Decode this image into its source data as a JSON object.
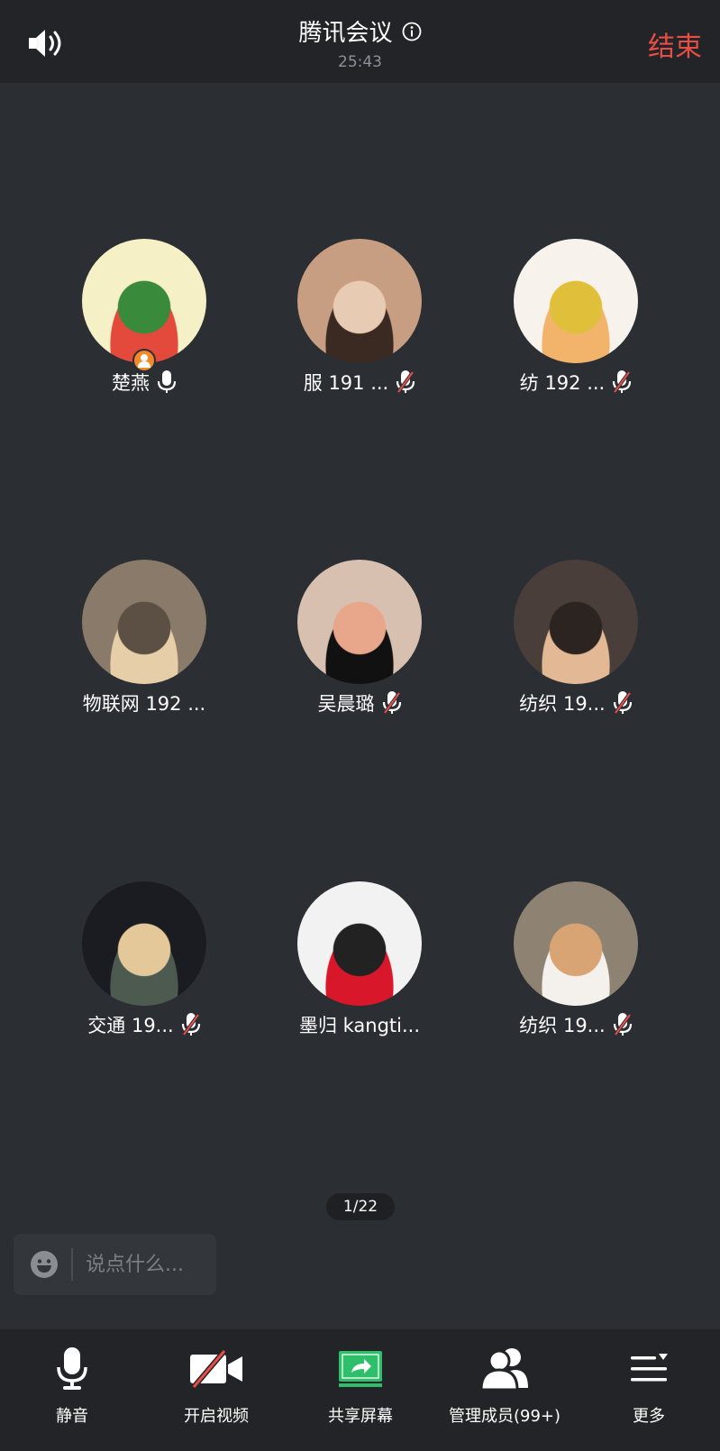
{
  "header": {
    "title": "腾讯会议",
    "timer": "25:43",
    "end_label": "结束"
  },
  "participants": [
    {
      "name": "楚燕",
      "mic": "on",
      "host": true,
      "avatar_colors": [
        "#f6f0c6",
        "#e34a3c",
        "#3a8a3c"
      ]
    },
    {
      "name": "服 191 ...",
      "mic": "muted",
      "host": false,
      "avatar_colors": [
        "#c79e82",
        "#3a2a22",
        "#e8cbb3"
      ]
    },
    {
      "name": "纺 192 ...",
      "mic": "muted",
      "host": false,
      "avatar_colors": [
        "#f7f3ec",
        "#f1b46a",
        "#e0c03a"
      ]
    },
    {
      "name": "物联网 192 ...",
      "mic": "none",
      "host": false,
      "avatar_colors": [
        "#8a7a6a",
        "#e6cfa8",
        "#5c4f44"
      ]
    },
    {
      "name": "吴晨璐",
      "mic": "muted",
      "host": false,
      "avatar_colors": [
        "#d8c0b0",
        "#111111",
        "#e8a68a"
      ]
    },
    {
      "name": "纺织 19...",
      "mic": "muted",
      "host": false,
      "avatar_colors": [
        "#4a3e3a",
        "#e3b894",
        "#2b2420"
      ]
    },
    {
      "name": "交通 19...",
      "mic": "muted",
      "host": false,
      "avatar_colors": [
        "#1a1c22",
        "#4c5a50",
        "#e5c89a"
      ]
    },
    {
      "name": "墨归 kangti...",
      "mic": "none",
      "host": false,
      "avatar_colors": [
        "#f2f2f2",
        "#d8182a",
        "#222222"
      ]
    },
    {
      "name": "纺织 19...",
      "mic": "muted",
      "host": false,
      "avatar_colors": [
        "#8e8272",
        "#f4f1ec",
        "#d9a473"
      ]
    }
  ],
  "pager": "1/22",
  "chat": {
    "placeholder": "说点什么..."
  },
  "toolbar": {
    "mute_label": "静音",
    "video_label": "开启视频",
    "share_label": "共享屏幕",
    "members_label": "管理成员(99+)",
    "more_label": "更多"
  },
  "colors": {
    "background": "#2b2e33",
    "bar": "#232427",
    "end": "#e84d46",
    "share_green": "#2fbf6a",
    "muted_red": "#e84d46"
  }
}
